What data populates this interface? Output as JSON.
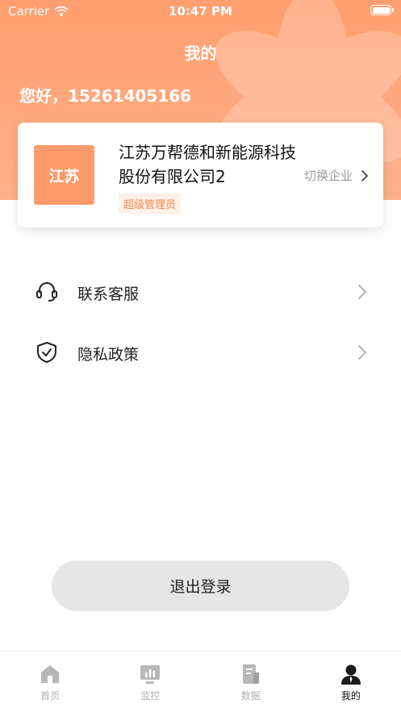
{
  "status_bar": {
    "carrier": "Carrier",
    "time": "10:47 PM"
  },
  "header": {
    "title": "我的",
    "greeting": "您好，15261405166"
  },
  "company": {
    "logo_text": "江苏",
    "name": "江苏万帮德和新能源科技股份有限公司2",
    "role": "超级管理员",
    "switch_label": "切换企业"
  },
  "menu": {
    "items": [
      {
        "label": "联系客服",
        "icon": "headset-icon"
      },
      {
        "label": "隐私政策",
        "icon": "shield-check-icon"
      }
    ]
  },
  "logout": {
    "label": "退出登录"
  },
  "tabs": [
    {
      "label": "首页",
      "icon": "home-icon",
      "active": false
    },
    {
      "label": "监控",
      "icon": "monitor-icon",
      "active": false
    },
    {
      "label": "数据",
      "icon": "data-icon",
      "active": false
    },
    {
      "label": "我的",
      "icon": "user-icon",
      "active": true
    }
  ],
  "colors": {
    "accent": "#ff9e6f",
    "badge_text": "#f08a4b",
    "inactive_tab": "#b0b0b0"
  }
}
